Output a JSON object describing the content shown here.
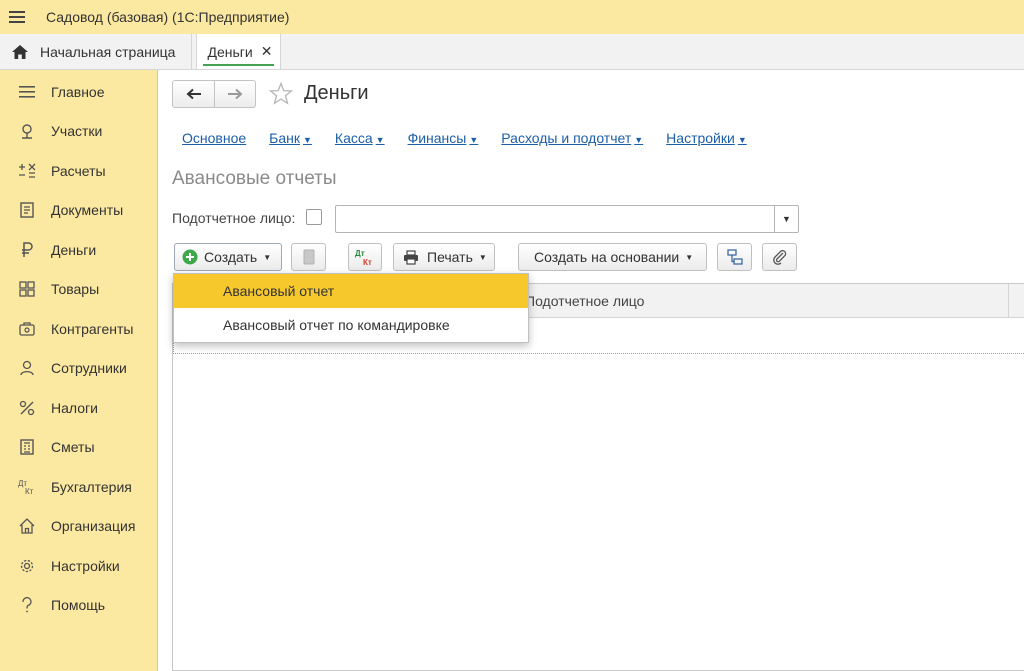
{
  "app": {
    "title": "Садовод (базовая)  (1С:Предприятие)"
  },
  "tabs": {
    "home": "Начальная страница",
    "active": "Деньги",
    "close": "✕"
  },
  "sidebar": {
    "items": [
      {
        "label": "Главное",
        "icon": "menu-lines-icon"
      },
      {
        "label": "Участки",
        "icon": "map-pin-icon"
      },
      {
        "label": "Расчеты",
        "icon": "calc-icon"
      },
      {
        "label": "Документы",
        "icon": "document-icon"
      },
      {
        "label": "Деньги",
        "icon": "ruble-icon"
      },
      {
        "label": "Товары",
        "icon": "boxes-icon"
      },
      {
        "label": "Контрагенты",
        "icon": "contractors-icon"
      },
      {
        "label": "Сотрудники",
        "icon": "person-icon"
      },
      {
        "label": "Налоги",
        "icon": "percent-icon"
      },
      {
        "label": "Сметы",
        "icon": "estimate-icon"
      },
      {
        "label": "Бухгалтерия",
        "icon": "accounting-icon"
      },
      {
        "label": "Организация",
        "icon": "house-icon"
      },
      {
        "label": "Настройки",
        "icon": "gear-icon"
      },
      {
        "label": "Помощь",
        "icon": "help-icon"
      }
    ]
  },
  "page": {
    "title": "Деньги",
    "section_title": "Авансовые отчеты"
  },
  "navlinks": [
    {
      "label": "Основное",
      "has_menu": false
    },
    {
      "label": "Банк",
      "has_menu": true
    },
    {
      "label": "Касса",
      "has_menu": true
    },
    {
      "label": "Финансы",
      "has_menu": true
    },
    {
      "label": "Расходы и подотчет",
      "has_menu": true
    },
    {
      "label": "Настройки",
      "has_menu": true
    }
  ],
  "filter": {
    "label": "Подотчетное лицо:",
    "value": ""
  },
  "toolbar": {
    "create_label": "Создать",
    "dtkt_label_top": "Дт",
    "dtkt_label_bottom": "Кт",
    "print_label": "Печать",
    "create_based_label": "Создать на основании"
  },
  "grid": {
    "columns": [
      "Подотчетное лицо"
    ]
  },
  "create_menu": {
    "items": [
      "Авансовый отчет",
      "Авансовый отчет по командировке"
    ],
    "selected_index": 0
  },
  "colors": {
    "panel_yellow": "#fbe8a1",
    "selection_yellow": "#f7c82c",
    "link_blue": "#1c5fa8",
    "create_green": "#3ea84a",
    "dtkt_green": "#2b8a3e",
    "dtkt_red": "#d23a2a"
  }
}
